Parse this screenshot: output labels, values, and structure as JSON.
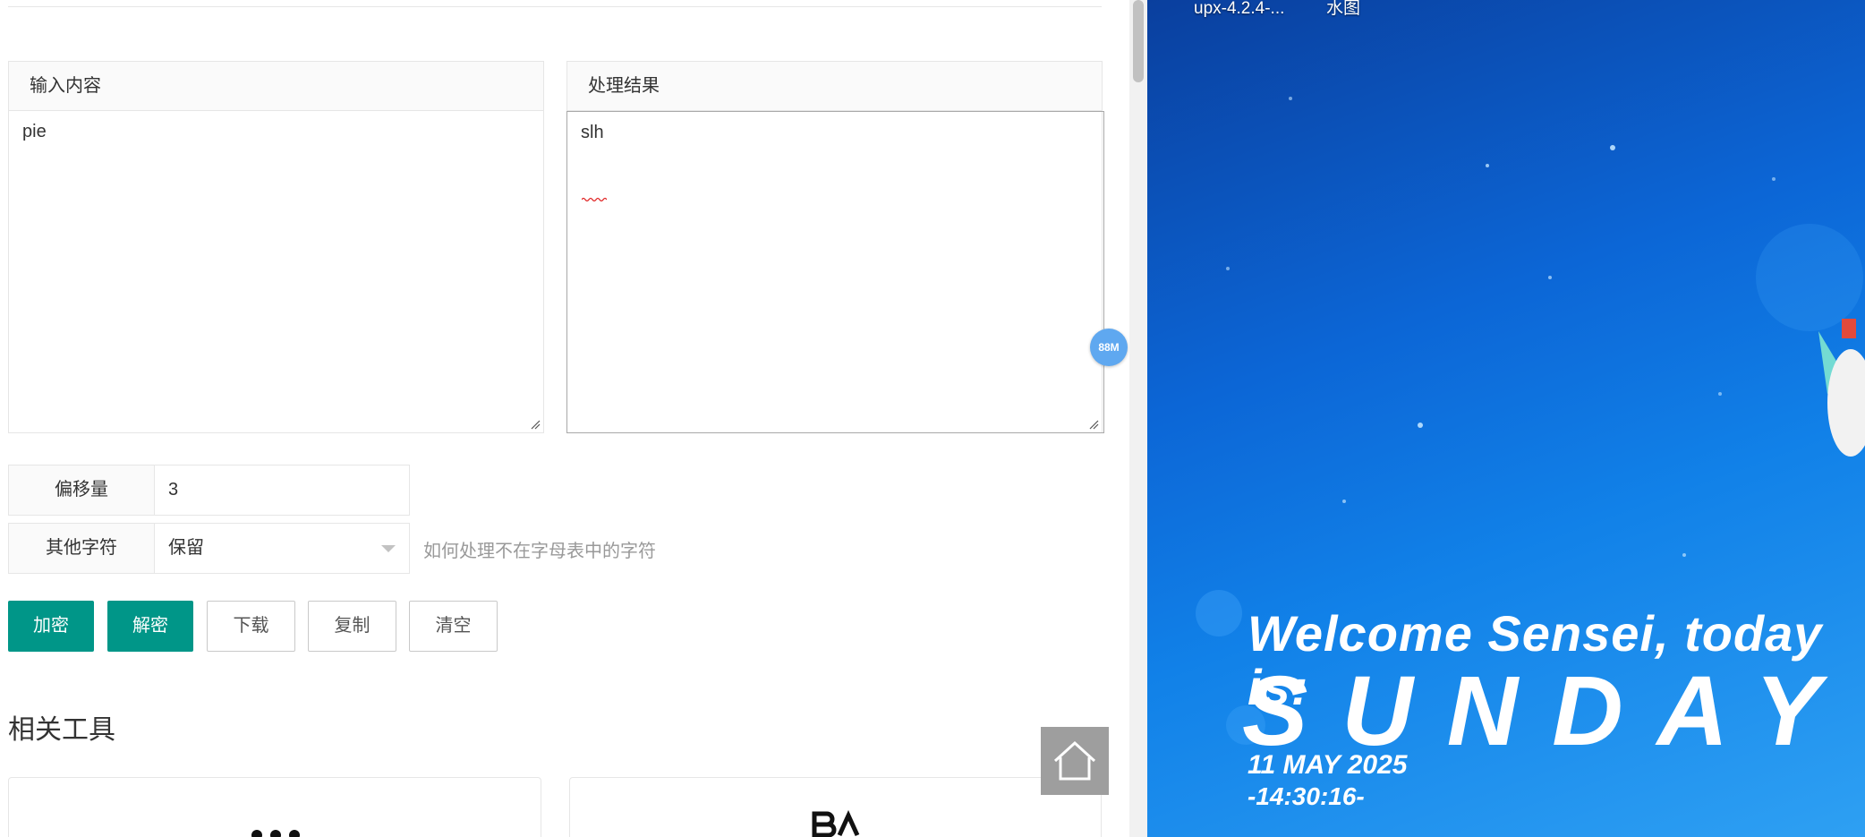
{
  "input_panel": {
    "title": "输入内容",
    "value": "pie"
  },
  "result_panel": {
    "title": "处理结果",
    "value": "slh"
  },
  "offset": {
    "label": "偏移量",
    "value": "3"
  },
  "other_chars": {
    "label": "其他字符",
    "selected": "保留",
    "hint": "如何处理不在字母表中的字符"
  },
  "buttons": {
    "encrypt": "加密",
    "decrypt": "解密",
    "download": "下载",
    "copy": "复制",
    "clear": "清空"
  },
  "related_tools": {
    "title": "相关工具"
  },
  "memory_badge": "88M",
  "desktop": {
    "labels": [
      "i",
      "upx-4.2.4-...",
      "水图"
    ],
    "welcome": "Welcome Sensei, today is:",
    "day": "SUNDAY",
    "date": "11 MAY 2025",
    "time": "-14:30:16-"
  },
  "colors": {
    "primary": "#009688",
    "badge": "#5fa8f0",
    "home": "#9e9e9e"
  },
  "icons": {
    "home": "home-icon",
    "select": "chevron-down-icon",
    "resize": "resize-grip-icon"
  }
}
